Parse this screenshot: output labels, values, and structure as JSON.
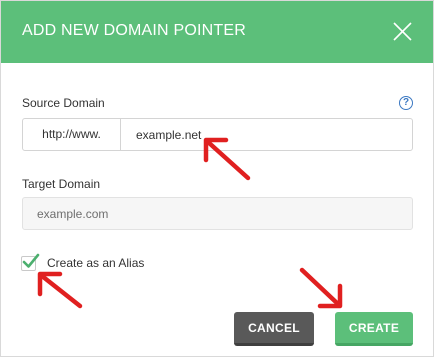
{
  "dialog": {
    "title": "ADD NEW DOMAIN POINTER",
    "close_icon": "close-x-icon"
  },
  "source": {
    "label": "Source Domain",
    "help_icon": "question-circle-icon",
    "help_glyph": "?",
    "prefix": "http://www.",
    "value": "example.net"
  },
  "target": {
    "label": "Target Domain",
    "placeholder": "example.com",
    "value": ""
  },
  "alias": {
    "label": "Create as an Alias",
    "checked": true
  },
  "buttons": {
    "cancel": "CANCEL",
    "create": "CREATE"
  },
  "colors": {
    "header_bg": "#5cbf7a",
    "create_bg": "#5cbf7a",
    "cancel_bg": "#595959",
    "annotation_arrow": "#e02020",
    "checkmark": "#4caf6e"
  },
  "annotations": {
    "arrow_icon": "red-arrow-icon"
  }
}
